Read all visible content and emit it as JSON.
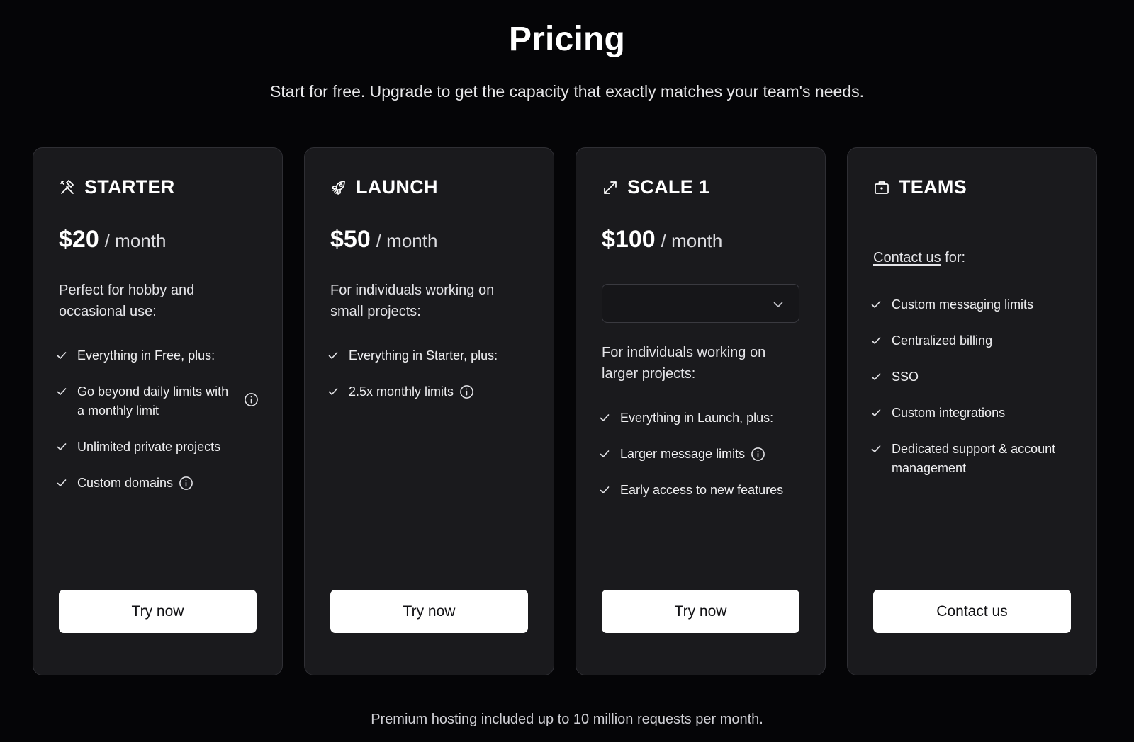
{
  "header": {
    "title": "Pricing",
    "subtitle": "Start for free. Upgrade to get the capacity that exactly matches your team's needs."
  },
  "plans": [
    {
      "icon": "tools-icon",
      "name": "STARTER",
      "price": "$20",
      "period": "/ month",
      "description": "Perfect for hobby and occasional use:",
      "features": [
        {
          "text": "Everything in Free, plus:",
          "info": false
        },
        {
          "text": "Go beyond daily limits with a monthly limit",
          "info": true
        },
        {
          "text": "Unlimited private projects",
          "info": false
        },
        {
          "text": "Custom domains",
          "info": true
        }
      ],
      "cta": "Try now"
    },
    {
      "icon": "rocket-icon",
      "name": "LAUNCH",
      "price": "$50",
      "period": "/ month",
      "description": "For individuals working on small projects:",
      "features": [
        {
          "text": "Everything in Starter, plus:",
          "info": false
        },
        {
          "text": "2.5x monthly limits",
          "info": true
        }
      ],
      "cta": "Try now"
    },
    {
      "icon": "expand-arrows-icon",
      "name": "SCALE 1",
      "price": "$100",
      "period": "/ month",
      "select_value": "",
      "description": "For individuals working on larger projects:",
      "features": [
        {
          "text": "Everything in Launch, plus:",
          "info": false
        },
        {
          "text": "Larger message limits",
          "info": true
        },
        {
          "text": "Early access to new features",
          "info": false
        }
      ],
      "cta": "Try now"
    },
    {
      "icon": "briefcase-icon",
      "name": "TEAMS",
      "contact_link": "Contact us",
      "contact_suffix": " for:",
      "features": [
        {
          "text": "Custom messaging limits",
          "info": false
        },
        {
          "text": "Centralized billing",
          "info": false
        },
        {
          "text": "SSO",
          "info": false
        },
        {
          "text": "Custom integrations",
          "info": false
        },
        {
          "text": "Dedicated support & account management",
          "info": false
        }
      ],
      "cta": "Contact us"
    }
  ],
  "footer": {
    "note": "Premium hosting included up to 10 million requests per month."
  },
  "colors": {
    "background": "#050507",
    "card": "#1a1a1d",
    "card_border": "#2f2f34",
    "button": "#ffffff",
    "button_text": "#111114"
  }
}
